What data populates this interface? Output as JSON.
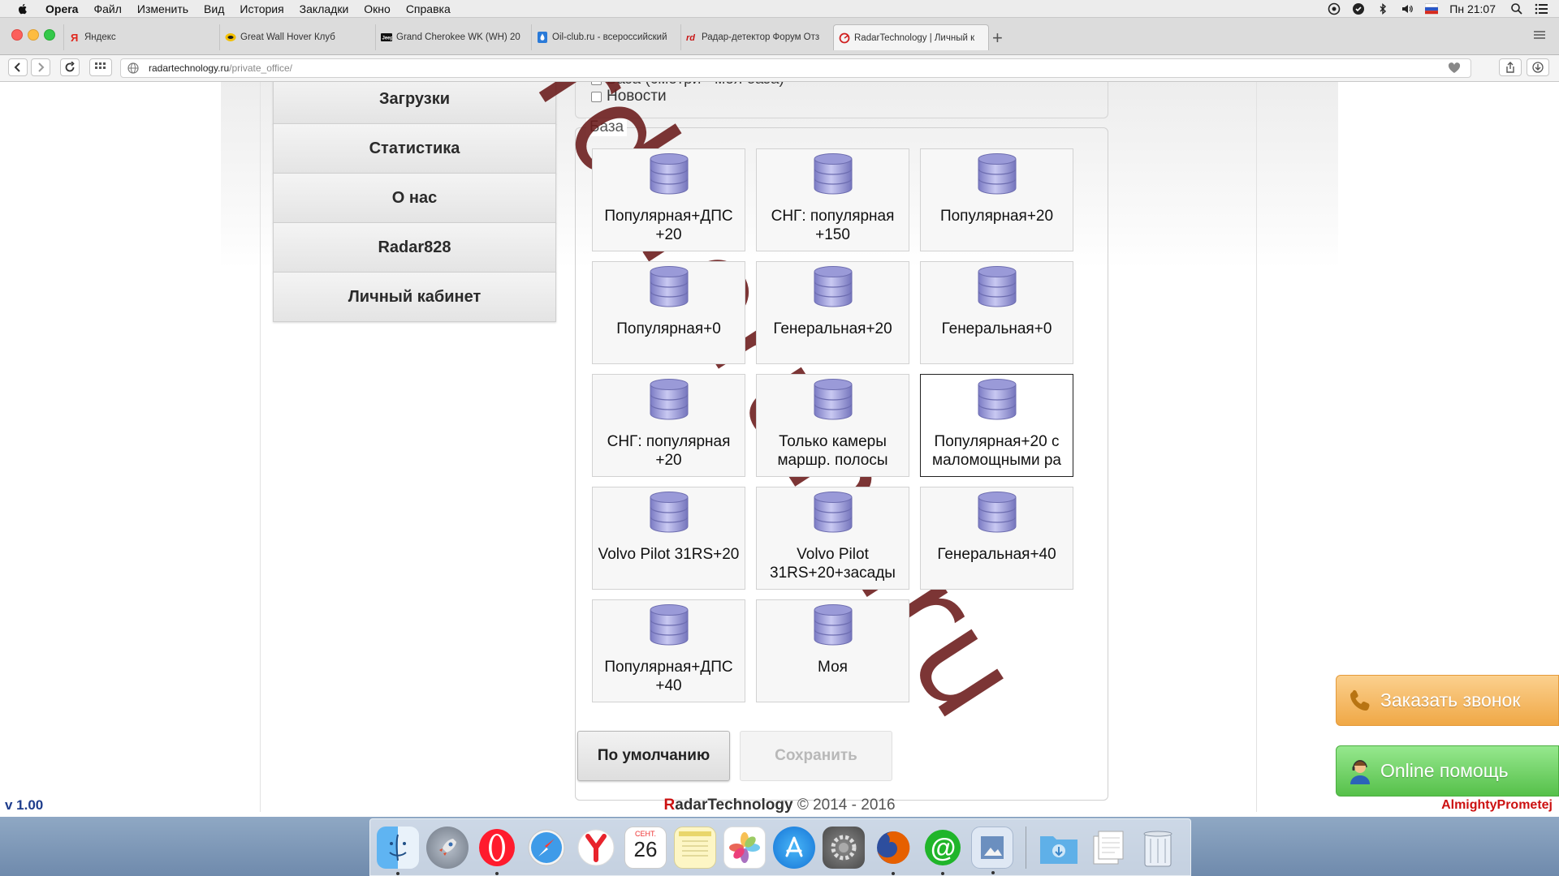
{
  "menubar": {
    "app_name": "Opera",
    "items": [
      "Файл",
      "Изменить",
      "Вид",
      "История",
      "Закладки",
      "Окно",
      "Справка"
    ],
    "clock": "Пн 21:07"
  },
  "tabs": [
    {
      "title": "Яндекс",
      "icon": "yandex-icon"
    },
    {
      "title": "Great Wall Hover Клуб",
      "icon": "greatwall-icon"
    },
    {
      "title": "Grand Cherokee WK (WH) 20",
      "icon": "jeep-icon"
    },
    {
      "title": "Oil-club.ru - всероссийский",
      "icon": "oil-drop-icon"
    },
    {
      "title": "Радар-детектор Форум Отз",
      "icon": "radar-forum-icon"
    },
    {
      "title": "RadarTechnology | Личный к",
      "icon": "radartech-icon",
      "active": true
    }
  ],
  "address": {
    "host": "radartechnology.ru",
    "path": "/private_office/"
  },
  "sidebar": {
    "items": [
      "Загрузки",
      "Статистика",
      "О нас",
      "Radar828",
      "Личный кабинет"
    ]
  },
  "news": {
    "partial_label": "База (смотри - моя база)",
    "news_label": "Новости"
  },
  "base": {
    "legend": "База",
    "tiles": [
      {
        "label": "Популярная+ДПС\n+20",
        "selected": false
      },
      {
        "label": "СНГ: популярная\n+150",
        "selected": false
      },
      {
        "label": "Популярная+20",
        "selected": false
      },
      {
        "label": "Популярная+0",
        "selected": false
      },
      {
        "label": "Генеральная+20",
        "selected": false
      },
      {
        "label": "Генеральная+0",
        "selected": false
      },
      {
        "label": "СНГ: популярная\n+20",
        "selected": false
      },
      {
        "label": "Только камеры\nмаршр. полосы",
        "selected": false
      },
      {
        "label": "Популярная+20 с\nмаломощными ра",
        "selected": true
      },
      {
        "label": "Volvo Pilot 31RS+20",
        "selected": false
      },
      {
        "label": "Volvo Pilot\n31RS+20+засады",
        "selected": false
      },
      {
        "label": "Генеральная+40",
        "selected": false
      },
      {
        "label": "Популярная+ДПС\n+40",
        "selected": false
      },
      {
        "label": "Моя",
        "selected": false
      }
    ]
  },
  "buttons": {
    "default_label": "По умолчанию",
    "save_label": "Сохранить"
  },
  "float": {
    "call_label": "Заказать звонок",
    "help_label": "Online помощь"
  },
  "footer": {
    "version": "v 1.00",
    "brand_r": "R",
    "brand_rest": "adarTechnology",
    "copyright": " © 2014 - 2016",
    "author": "AlmightyPrometej"
  },
  "watermark": "rd-forum.ru",
  "dock": {
    "calendar_month": "СЕНТ.",
    "calendar_day": "26",
    "apps": [
      "finder-icon",
      "launchpad-icon",
      "opera-icon",
      "safari-icon",
      "yandex-browser-icon",
      "calendar-icon",
      "notes-icon",
      "photos-icon",
      "app-store-icon",
      "system-preferences-icon",
      "firefox-icon",
      "mail-ru-agent-icon",
      "preview-icon",
      "downloads-folder-icon",
      "documents-stack-icon",
      "trash-icon"
    ]
  },
  "colors": {
    "accent_red": "#cc1111",
    "version_blue": "#1e3d8c",
    "call_orange": "#f0a846",
    "help_green": "#56c04a",
    "watermark": "#6a1a1a",
    "db_icon": "#9a9ad8"
  }
}
